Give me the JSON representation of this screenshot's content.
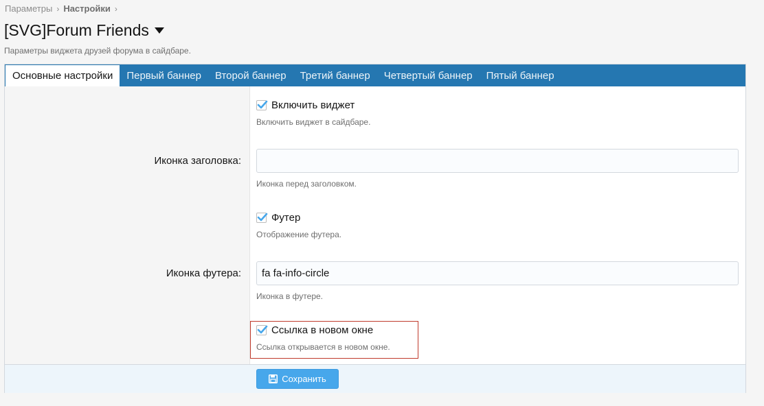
{
  "breadcrumb": {
    "items": [
      "Параметры",
      "Настройки"
    ]
  },
  "header": {
    "title": "[SVG]Forum Friends",
    "description": "Параметры виджета друзей форума в сайдбаре."
  },
  "tabs": [
    {
      "label": "Основные настройки",
      "active": true
    },
    {
      "label": "Первый баннер"
    },
    {
      "label": "Второй баннер"
    },
    {
      "label": "Третий баннер"
    },
    {
      "label": "Четвертый баннер"
    },
    {
      "label": "Пятый баннер"
    }
  ],
  "form": {
    "enable_widget": {
      "label": "Включить виджет",
      "hint": "Включить виджет в сайдбаре.",
      "checked": true
    },
    "title_icon": {
      "label": "Иконка заголовка:",
      "value": "",
      "hint": "Иконка перед заголовком."
    },
    "footer": {
      "label": "Футер",
      "hint": "Отображение футера.",
      "checked": true
    },
    "footer_icon": {
      "label": "Иконка футера:",
      "value": "fa fa-info-circle",
      "hint": "Иконка в футере."
    },
    "new_window": {
      "label": "Ссылка в новом окне",
      "hint": "Ссылка открывается в новом окне.",
      "checked": true
    }
  },
  "actions": {
    "save_label": "Сохранить"
  },
  "colors": {
    "accent": "#2577b1",
    "button": "#47a7eb",
    "checkbox": "#47a7eb",
    "highlight": "#c0392b"
  }
}
